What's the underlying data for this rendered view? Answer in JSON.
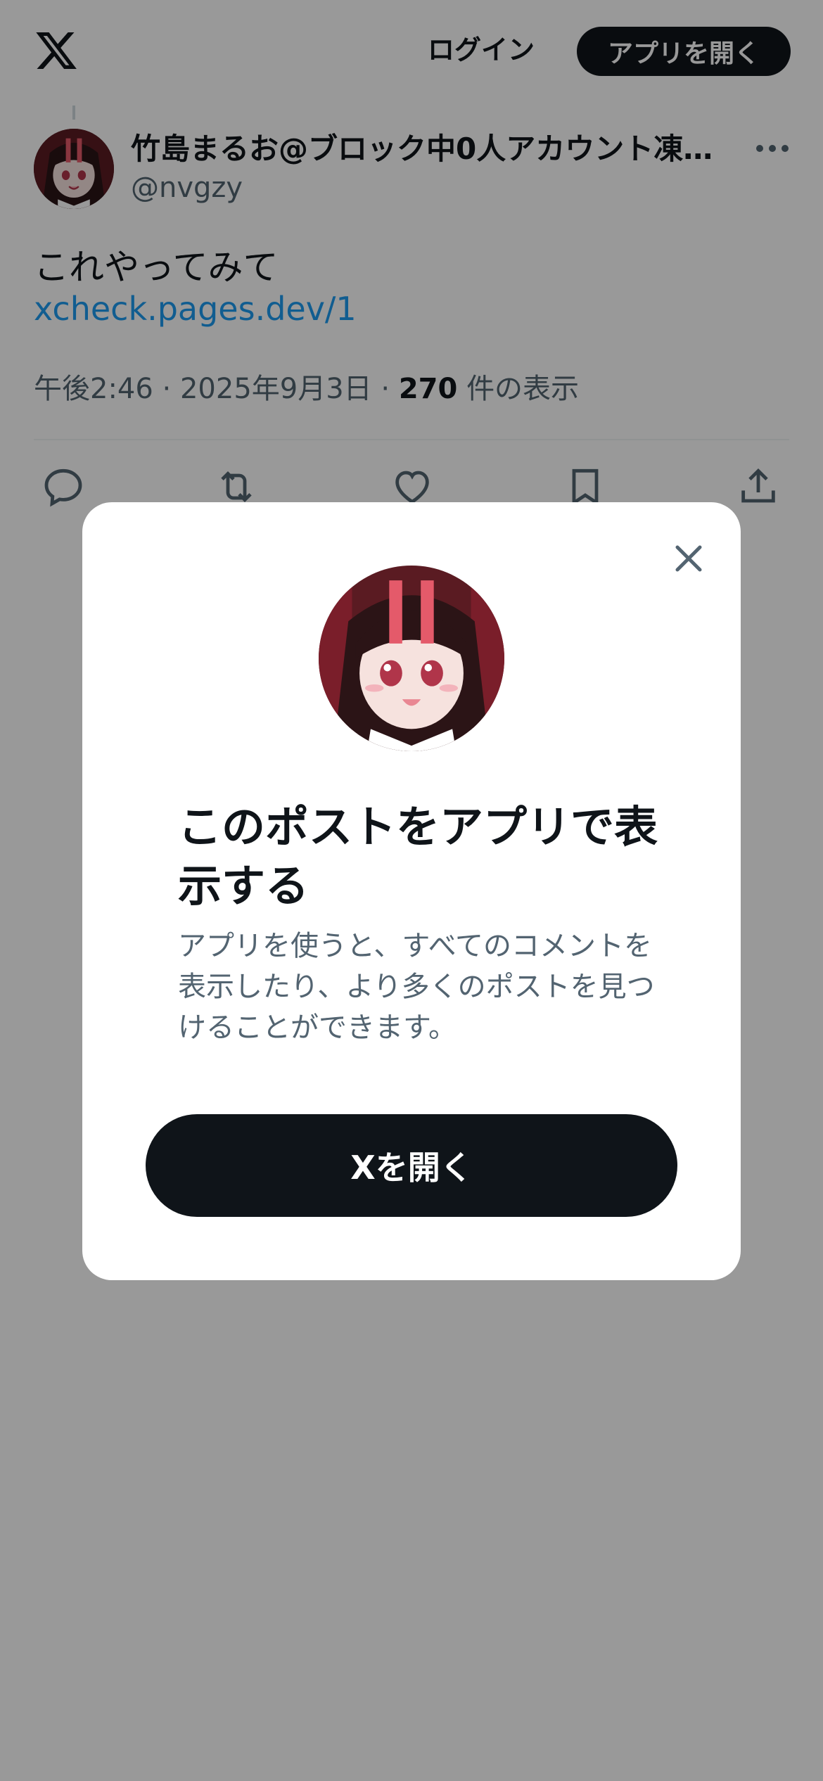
{
  "topbar": {
    "logo": "x-logo-icon",
    "login_label": "ログイン",
    "open_app_label": "アプリを開く"
  },
  "post": {
    "author_name": "竹島まるお@ブロック中0人アカウント凍…",
    "author_handle": "@nvgzy",
    "text": "これやってみて",
    "link": "xcheck.pages.dev/1",
    "time": "午後2:46",
    "date": "2025年9月3日",
    "views_count": "270",
    "views_label": "件の表示",
    "separator": "·"
  },
  "actions": [
    "reply-icon",
    "repost-icon",
    "like-icon",
    "bookmark-icon",
    "share-icon"
  ],
  "modal": {
    "title": "このポストをアプリで表示する",
    "description": "アプリを使うと、すべてのコメントを表示したり、より多くのポストを見つけることができます。",
    "button_label": "Xを開く"
  },
  "colors": {
    "text_primary": "#0f1419",
    "text_secondary": "#536471",
    "link": "#1d9bf0",
    "button_dark": "#0f1419",
    "overlay": "rgba(0,0,0,0.4)"
  }
}
